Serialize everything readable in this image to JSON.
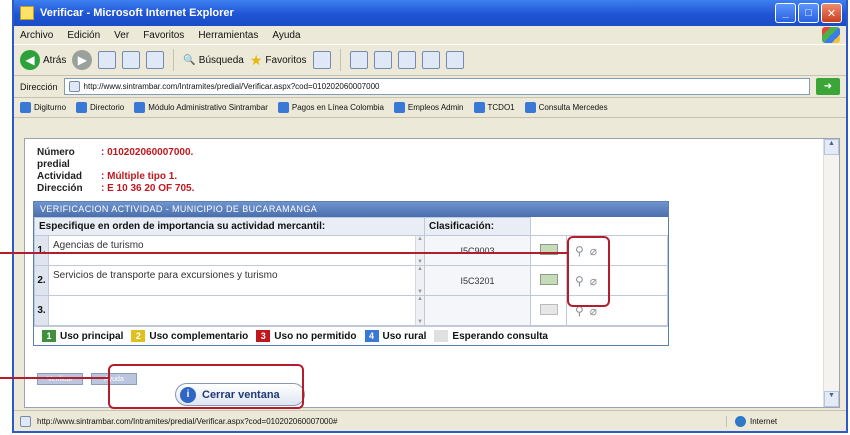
{
  "window": {
    "title": "Verificar - Microsoft Internet Explorer"
  },
  "menu": [
    "Archivo",
    "Edición",
    "Ver",
    "Favoritos",
    "Herramientas",
    "Ayuda"
  ],
  "toolbar": {
    "back_label": "Atrás",
    "search_label": "Búsqueda",
    "favorites_label": "Favoritos"
  },
  "address": {
    "label": "Dirección",
    "url": "http://www.sintrambar.com/Intramites/predial/Verificar.aspx?cod=010202060007000"
  },
  "links": [
    "Digiturno",
    "Directorio",
    "Módulo Administrativo Sintrambar",
    "Pagos en Línea Colombia",
    "Empleos Admin",
    "TCDO1",
    "Consulta Mercedes"
  ],
  "info": {
    "predio_label": "Número predial",
    "predio_value": ": 010202060007000.",
    "actividad_label": "Actividad",
    "actividad_value": ": Múltiple tipo 1.",
    "direccion_label": "Dirección",
    "direccion_value": ": E 10 36 20 OF 705."
  },
  "panel": {
    "title": "VERIFICACION ACTIVIDAD - MUNICIPIO DE BUCARAMANGA",
    "col_activity": "Especifique en orden de importancia su actividad mercantil:",
    "col_class": "Clasificación:"
  },
  "rows": [
    {
      "num": "1.",
      "activity": "Agencias de turismo",
      "code": "I5C9003"
    },
    {
      "num": "2.",
      "activity": "Servicios de transporte para excursiones y turismo",
      "code": "I5C3201"
    },
    {
      "num": "3.",
      "activity": "",
      "code": ""
    }
  ],
  "legend": [
    {
      "num": "1",
      "label": "Uso principal",
      "color": "#3f8f3c"
    },
    {
      "num": "2",
      "label": "Uso complementario",
      "color": "#e0c020"
    },
    {
      "num": "3",
      "label": "Uso no permitido",
      "color": "#c0171e"
    },
    {
      "num": "4",
      "label": "Uso rural",
      "color": "#3a78d6"
    },
    {
      "num": "",
      "label": "Esperando consulta",
      "color": "#e0e0e0"
    }
  ],
  "buttons": {
    "small1": "Verificar",
    "small2": "Ayuda",
    "close_label": "Cerrar ventana"
  },
  "status": {
    "url": "http://www.sintrambar.com/Intramites/predial/Verificar.aspx?cod=010202060007000#",
    "zone": "Internet"
  }
}
